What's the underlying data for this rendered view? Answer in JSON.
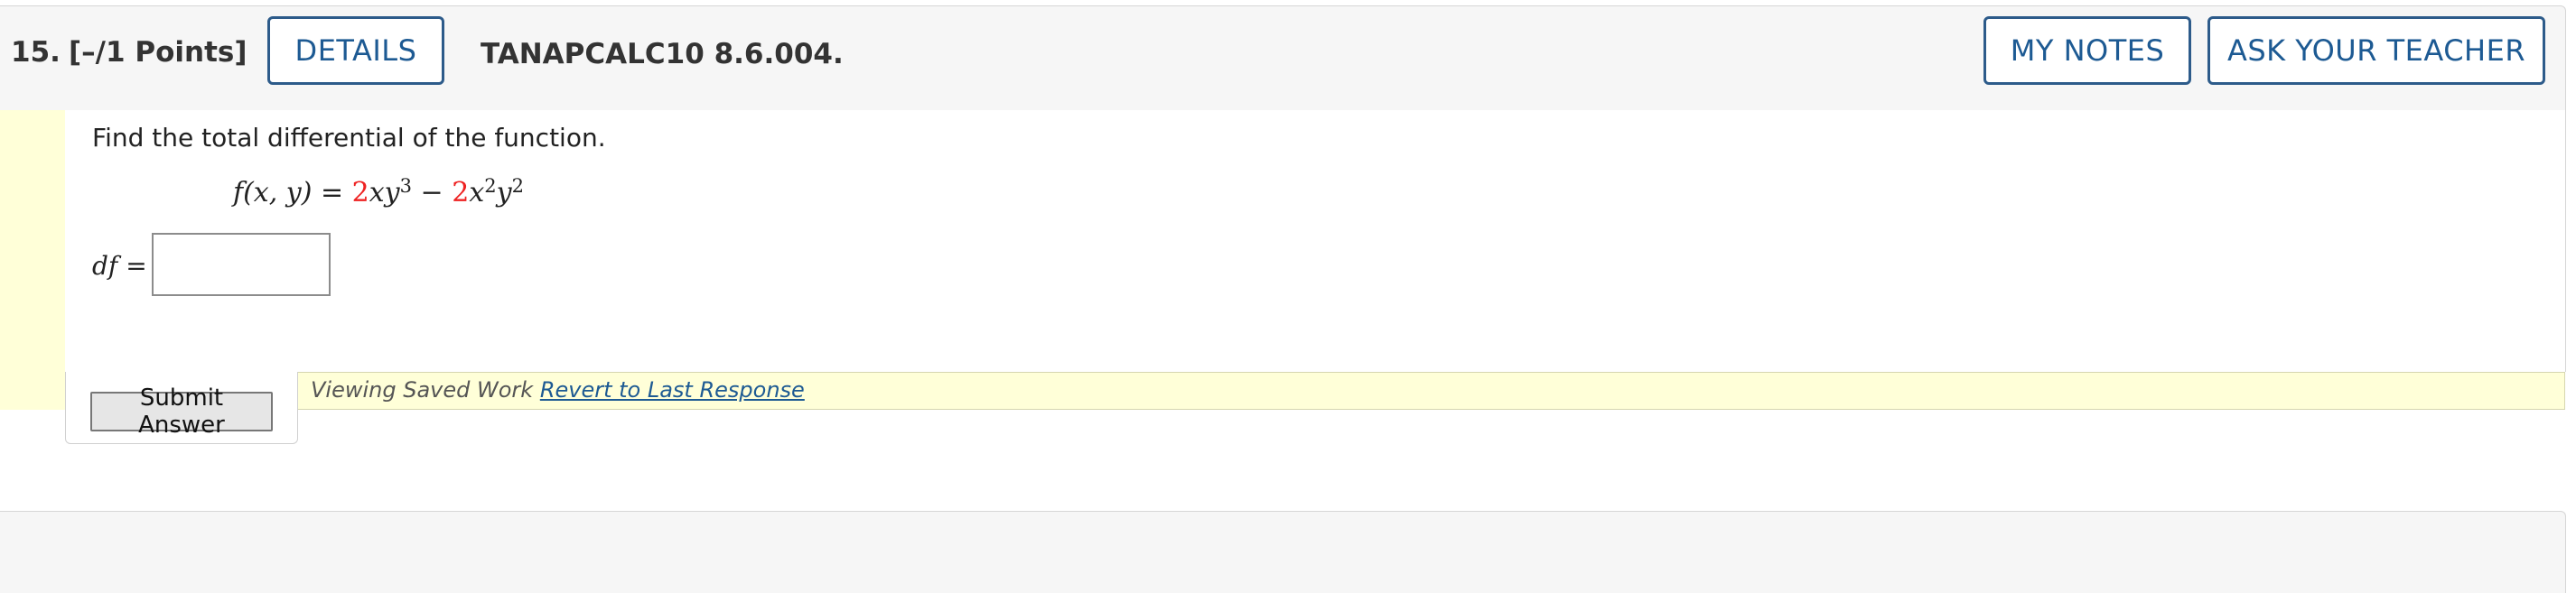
{
  "question": {
    "number": "15.",
    "points": "[–/1 Points]",
    "details_label": "DETAILS",
    "code": "TANAPCALC10 8.6.004.",
    "my_notes_label": "MY NOTES",
    "ask_teacher_label": "ASK YOUR TEACHER"
  },
  "problem": {
    "prompt": "Find the total differential of the function.",
    "formula": {
      "lhs": "f(x, y) = ",
      "coef1": "2",
      "term1": "xy",
      "exp1": "3",
      "minus": " − ",
      "coef2": "2",
      "term2a": "x",
      "exp2a": "2",
      "term2b": "y",
      "exp2b": "2"
    },
    "answer_label": "df",
    "answer_eq": " =",
    "answer_value": ""
  },
  "footer": {
    "submit_label": "Submit Answer",
    "saved_text": "Viewing Saved Work ",
    "revert_label": "Revert to Last Response"
  },
  "colors": {
    "accent": "#1d5a93",
    "highlight": "#ffffd8",
    "formula_coef": "#e22222"
  }
}
